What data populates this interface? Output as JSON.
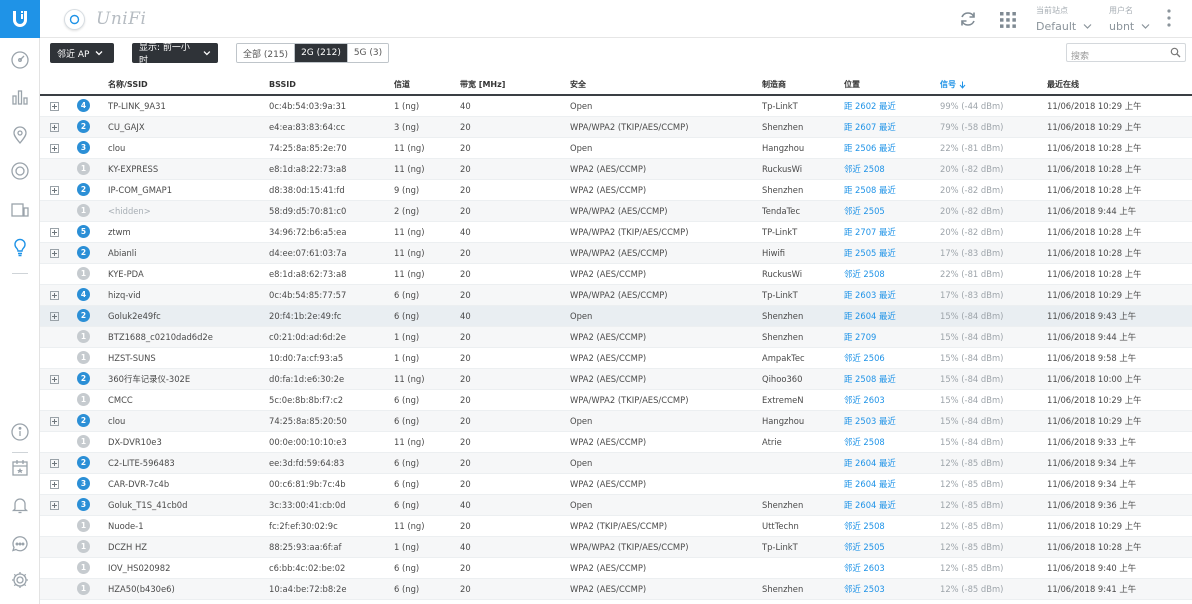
{
  "app": {
    "brand": "UniFi"
  },
  "header": {
    "site_label": "当前站点",
    "site_value": "Default",
    "user_label": "用户名",
    "user_value": "ubnt"
  },
  "toolbar": {
    "filter_label": "邻近 AP",
    "time_label": "显示: 前一小时",
    "seg_all": "全部 (215)",
    "seg_2g": "2G (212)",
    "seg_5g": "5G (3)",
    "search_placeholder": "搜索"
  },
  "colors": {
    "accent": "#1f93e7",
    "dark": "#2f3338",
    "badge_gray": "#c6cbcf"
  },
  "table": {
    "headers": [
      "名称/SSID",
      "BSSID",
      "信道",
      "带宽 [MHz]",
      "安全",
      "制造商",
      "位置",
      "信号",
      "最近在线"
    ],
    "rows": [
      {
        "exp": true,
        "badge": "4",
        "name": "TP-LINK_9A31",
        "bssid": "0c:4b:54:03:9a:31",
        "ch": "1 (ng)",
        "bw": "40",
        "sec": "Open",
        "mfr": "Tp-LinkT",
        "loc": "距 2602 最近",
        "sig": "99% (-44 dBm)",
        "seen": "11/06/2018 10:29 上午"
      },
      {
        "exp": true,
        "badge": "2",
        "name": "CU_GAJX",
        "bssid": "e4:ea:83:83:64:cc",
        "ch": "3 (ng)",
        "bw": "20",
        "sec": "WPA/WPA2 (TKIP/AES/CCMP)",
        "mfr": "Shenzhen",
        "loc": "距 2607 最近",
        "sig": "79% (-58 dBm)",
        "seen": "11/06/2018 10:29 上午"
      },
      {
        "exp": true,
        "badge": "3",
        "name": "clou",
        "bssid": "74:25:8a:85:2e:70",
        "ch": "11 (ng)",
        "bw": "20",
        "sec": "Open",
        "mfr": "Hangzhou",
        "loc": "距 2506 最近",
        "sig": "22% (-81 dBm)",
        "seen": "11/06/2018 10:28 上午"
      },
      {
        "exp": false,
        "badge": "1",
        "name": "KY-EXPRESS",
        "bssid": "e8:1d:a8:22:73:a8",
        "ch": "11 (ng)",
        "bw": "20",
        "sec": "WPA2 (AES/CCMP)",
        "mfr": "RuckusWi",
        "loc": "邻近 2508",
        "sig": "20% (-82 dBm)",
        "seen": "11/06/2018 10:28 上午"
      },
      {
        "exp": true,
        "badge": "2",
        "name": "IP-COM_GMAP1",
        "bssid": "d8:38:0d:15:41:fd",
        "ch": "9 (ng)",
        "bw": "20",
        "sec": "WPA2 (AES/CCMP)",
        "mfr": "Shenzhen",
        "loc": "距 2508 最近",
        "sig": "20% (-82 dBm)",
        "seen": "11/06/2018 10:28 上午"
      },
      {
        "exp": false,
        "badge": "1",
        "name": "<hidden>",
        "bssid": "58:d9:d5:70:81:c0",
        "ch": "2 (ng)",
        "bw": "20",
        "sec": "WPA/WPA2 (AES/CCMP)",
        "mfr": "TendaTec",
        "loc": "邻近 2505",
        "sig": "20% (-82 dBm)",
        "seen": "11/06/2018 9:44 上午"
      },
      {
        "exp": true,
        "badge": "5",
        "name": "ztwm",
        "bssid": "34:96:72:b6:a5:ea",
        "ch": "11 (ng)",
        "bw": "40",
        "sec": "WPA/WPA2 (TKIP/AES/CCMP)",
        "mfr": "TP-LinkT",
        "loc": "距 2707 最近",
        "sig": "20% (-82 dBm)",
        "seen": "11/06/2018 10:28 上午"
      },
      {
        "exp": true,
        "badge": "2",
        "name": "Abianli",
        "bssid": "d4:ee:07:61:03:7a",
        "ch": "11 (ng)",
        "bw": "20",
        "sec": "WPA/WPA2 (AES/CCMP)",
        "mfr": "Hiwifi",
        "loc": "距 2505 最近",
        "sig": "17% (-83 dBm)",
        "seen": "11/06/2018 10:28 上午"
      },
      {
        "exp": false,
        "badge": "1",
        "name": "KYE-PDA",
        "bssid": "e8:1d:a8:62:73:a8",
        "ch": "11 (ng)",
        "bw": "20",
        "sec": "WPA2 (AES/CCMP)",
        "mfr": "RuckusWi",
        "loc": "邻近 2508",
        "sig": "22% (-81 dBm)",
        "seen": "11/06/2018 10:28 上午"
      },
      {
        "exp": true,
        "badge": "4",
        "name": "hizq-vid",
        "bssid": "0c:4b:54:85:77:57",
        "ch": "6 (ng)",
        "bw": "20",
        "sec": "WPA/WPA2 (AES/CCMP)",
        "mfr": "Tp-LinkT",
        "loc": "距 2603 最近",
        "sig": "17% (-83 dBm)",
        "seen": "11/06/2018 10:29 上午"
      },
      {
        "exp": true,
        "badge": "2",
        "name": "Goluk2e49fc",
        "bssid": "20:f4:1b:2e:49:fc",
        "ch": "6 (ng)",
        "bw": "40",
        "sec": "Open",
        "mfr": "Shenzhen",
        "loc": "距 2604 最近",
        "sig": "15% (-84 dBm)",
        "seen": "11/06/2018 9:43 上午"
      },
      {
        "exp": false,
        "badge": "1",
        "name": "BTZ1688_c0210dad6d2e",
        "bssid": "c0:21:0d:ad:6d:2e",
        "ch": "1 (ng)",
        "bw": "20",
        "sec": "WPA2 (AES/CCMP)",
        "mfr": "Shenzhen",
        "loc": "距 2709",
        "sig": "15% (-84 dBm)",
        "seen": "11/06/2018 9:44 上午"
      },
      {
        "exp": false,
        "badge": "1",
        "name": "HZST-SUNS",
        "bssid": "10:d0:7a:cf:93:a5",
        "ch": "1 (ng)",
        "bw": "20",
        "sec": "WPA2 (AES/CCMP)",
        "mfr": "AmpakTec",
        "loc": "邻近 2506",
        "sig": "15% (-84 dBm)",
        "seen": "11/06/2018 9:58 上午"
      },
      {
        "exp": true,
        "badge": "2",
        "name": "360行车记录仪-302E",
        "bssid": "d0:fa:1d:e6:30:2e",
        "ch": "11 (ng)",
        "bw": "20",
        "sec": "WPA2 (AES/CCMP)",
        "mfr": "Qihoo360",
        "loc": "距 2508 最近",
        "sig": "15% (-84 dBm)",
        "seen": "11/06/2018 10:00 上午"
      },
      {
        "exp": false,
        "badge": "1",
        "name": "CMCC",
        "bssid": "5c:0e:8b:8b:f7:c2",
        "ch": "6 (ng)",
        "bw": "20",
        "sec": "WPA/WPA2 (TKIP/AES/CCMP)",
        "mfr": "ExtremeN",
        "loc": "邻近 2603",
        "sig": "15% (-84 dBm)",
        "seen": "11/06/2018 10:29 上午"
      },
      {
        "exp": true,
        "badge": "2",
        "name": "clou",
        "bssid": "74:25:8a:85:20:50",
        "ch": "6 (ng)",
        "bw": "20",
        "sec": "Open",
        "mfr": "Hangzhou",
        "loc": "距 2503 最近",
        "sig": "15% (-84 dBm)",
        "seen": "11/06/2018 10:29 上午"
      },
      {
        "exp": false,
        "badge": "1",
        "name": "DX-DVR10e3",
        "bssid": "00:0e:00:10:10:e3",
        "ch": "11 (ng)",
        "bw": "20",
        "sec": "WPA2 (AES/CCMP)",
        "mfr": "Atrie",
        "loc": "邻近 2508",
        "sig": "15% (-84 dBm)",
        "seen": "11/06/2018 9:33 上午"
      },
      {
        "exp": true,
        "badge": "2",
        "name": "C2-LITE-596483",
        "bssid": "ee:3d:fd:59:64:83",
        "ch": "6 (ng)",
        "bw": "20",
        "sec": "Open",
        "mfr": "",
        "loc": "距 2604 最近",
        "sig": "12% (-85 dBm)",
        "seen": "11/06/2018 9:34 上午"
      },
      {
        "exp": true,
        "badge": "3",
        "name": "CAR-DVR-7c4b",
        "bssid": "00:c6:81:9b:7c:4b",
        "ch": "6 (ng)",
        "bw": "20",
        "sec": "WPA2 (AES/CCMP)",
        "mfr": "",
        "loc": "距 2604 最近",
        "sig": "12% (-85 dBm)",
        "seen": "11/06/2018 9:34 上午"
      },
      {
        "exp": true,
        "badge": "3",
        "name": "Goluk_T1S_41cb0d",
        "bssid": "3c:33:00:41:cb:0d",
        "ch": "6 (ng)",
        "bw": "40",
        "sec": "Open",
        "mfr": "Shenzhen",
        "loc": "距 2604 最近",
        "sig": "12% (-85 dBm)",
        "seen": "11/06/2018 9:36 上午"
      },
      {
        "exp": false,
        "badge": "1",
        "name": "Nuode-1",
        "bssid": "fc:2f:ef:30:02:9c",
        "ch": "11 (ng)",
        "bw": "20",
        "sec": "WPA2 (TKIP/AES/CCMP)",
        "mfr": "UttTechn",
        "loc": "邻近 2508",
        "sig": "12% (-85 dBm)",
        "seen": "11/06/2018 10:29 上午"
      },
      {
        "exp": false,
        "badge": "1",
        "name": "DCZH HZ",
        "bssid": "88:25:93:aa:6f:af",
        "ch": "1 (ng)",
        "bw": "40",
        "sec": "WPA/WPA2 (TKIP/AES/CCMP)",
        "mfr": "Tp-LinkT",
        "loc": "邻近 2505",
        "sig": "12% (-85 dBm)",
        "seen": "11/06/2018 10:28 上午"
      },
      {
        "exp": false,
        "badge": "1",
        "name": "IOV_HS020982",
        "bssid": "c6:bb:4c:02:be:02",
        "ch": "6 (ng)",
        "bw": "20",
        "sec": "WPA2 (AES/CCMP)",
        "mfr": "",
        "loc": "邻近 2603",
        "sig": "12% (-85 dBm)",
        "seen": "11/06/2018 9:40 上午"
      },
      {
        "exp": false,
        "badge": "1",
        "name": "HZA50(b430e6)",
        "bssid": "10:a4:be:72:b8:2e",
        "ch": "6 (ng)",
        "bw": "20",
        "sec": "WPA2 (AES/CCMP)",
        "mfr": "Shenzhen",
        "loc": "邻近 2503",
        "sig": "12% (-85 dBm)",
        "seen": "11/06/2018 9:41 上午"
      }
    ]
  }
}
